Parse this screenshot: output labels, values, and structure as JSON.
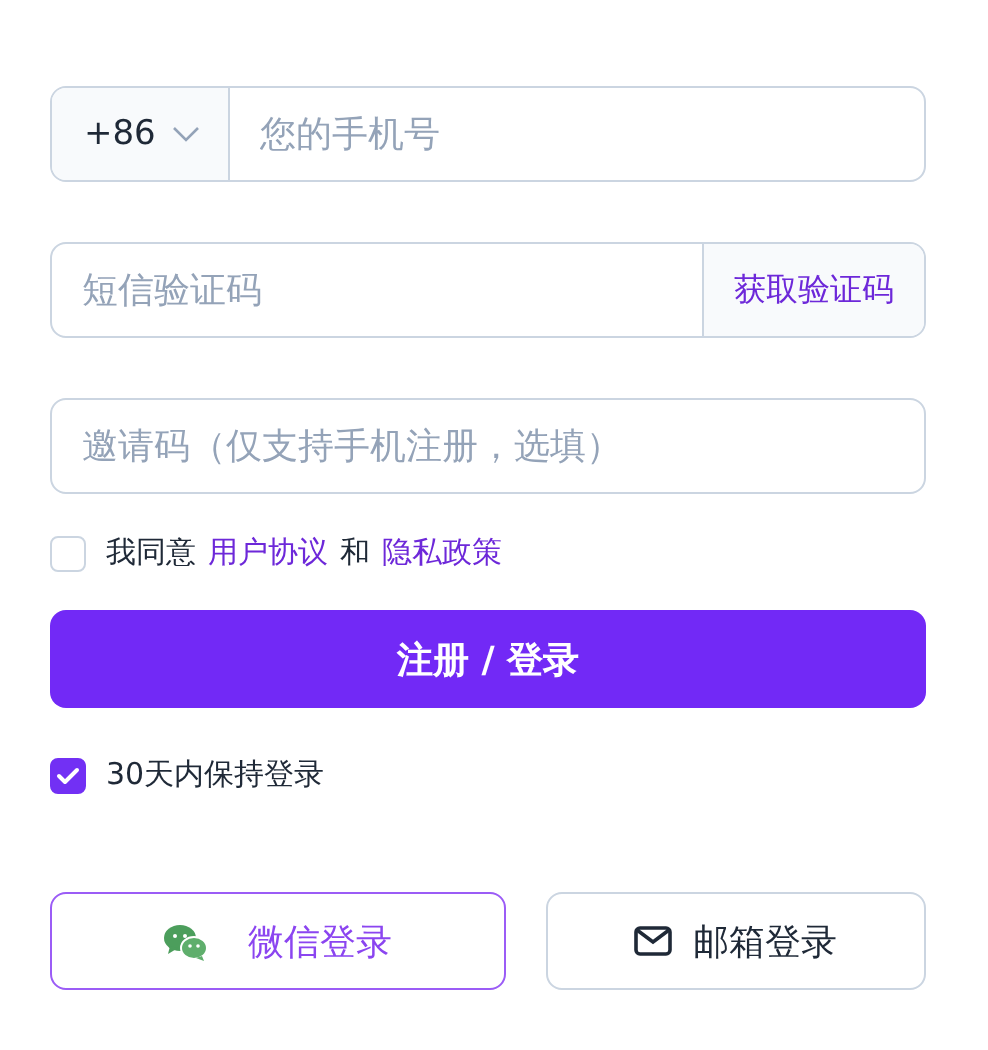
{
  "phone": {
    "country_code": "+86",
    "placeholder": "您的手机号"
  },
  "sms_code": {
    "placeholder": "短信验证码",
    "button": "获取验证码"
  },
  "invite_code": {
    "placeholder": "邀请码（仅支持手机注册，选填）"
  },
  "agreement": {
    "checked": false,
    "prefix": "我同意",
    "link1": "用户协议",
    "conjunction": "和",
    "link2": "隐私政策"
  },
  "submit": {
    "label": "注册 / 登录"
  },
  "remember": {
    "checked": true,
    "label": "30天内保持登录"
  },
  "social_buttons": [
    {
      "kind": "wechat",
      "label": "微信登录",
      "active": true
    },
    {
      "kind": "email",
      "label": "邮箱登录",
      "active": false
    }
  ]
}
